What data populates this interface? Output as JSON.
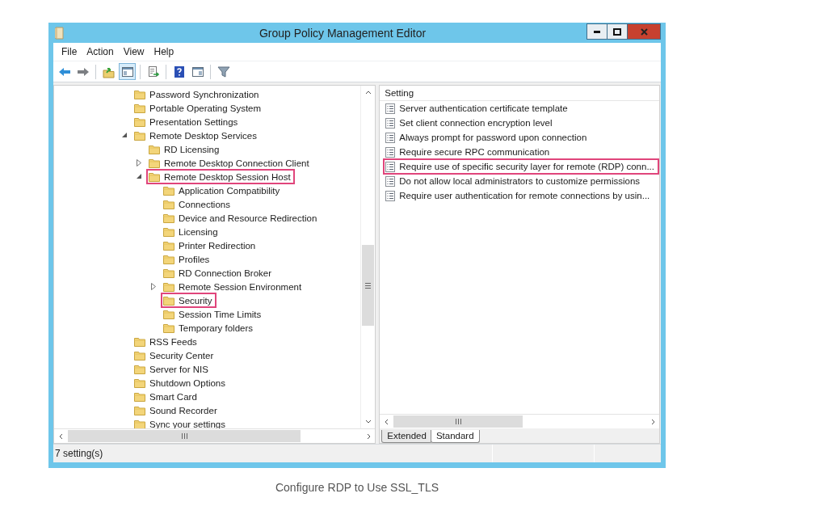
{
  "window": {
    "title": "Group Policy Management Editor"
  },
  "menu": [
    "File",
    "Action",
    "View",
    "Help"
  ],
  "tree": {
    "items": [
      {
        "label": "Password Synchronization",
        "highlighted": false
      },
      {
        "label": "Portable Operating System",
        "highlighted": false
      },
      {
        "label": "Presentation Settings",
        "highlighted": false
      },
      {
        "label": "Remote Desktop Services",
        "highlighted": false,
        "expanded": true,
        "children": [
          {
            "label": "RD Licensing",
            "highlighted": false
          },
          {
            "label": "Remote Desktop Connection Client",
            "highlighted": false,
            "expanded": false
          },
          {
            "label": "Remote Desktop Session Host",
            "highlighted": true,
            "expanded": true,
            "children": [
              {
                "label": "Application Compatibility",
                "highlighted": false
              },
              {
                "label": "Connections",
                "highlighted": false
              },
              {
                "label": "Device and Resource Redirection",
                "highlighted": false
              },
              {
                "label": "Licensing",
                "highlighted": false
              },
              {
                "label": "Printer Redirection",
                "highlighted": false
              },
              {
                "label": "Profiles",
                "highlighted": false
              },
              {
                "label": "RD Connection Broker",
                "highlighted": false
              },
              {
                "label": "Remote Session Environment",
                "highlighted": false,
                "expanded": false
              },
              {
                "label": "Security",
                "highlighted": true
              },
              {
                "label": "Session Time Limits",
                "highlighted": false
              },
              {
                "label": "Temporary folders",
                "highlighted": false
              }
            ]
          }
        ]
      },
      {
        "label": "RSS Feeds",
        "highlighted": false
      },
      {
        "label": "Security Center",
        "highlighted": false
      },
      {
        "label": "Server for NIS",
        "highlighted": false
      },
      {
        "label": "Shutdown Options",
        "highlighted": false
      },
      {
        "label": "Smart Card",
        "highlighted": false
      },
      {
        "label": "Sound Recorder",
        "highlighted": false
      },
      {
        "label": "Sync your settings",
        "highlighted": false
      }
    ]
  },
  "settings_list": {
    "header": "Setting",
    "items": [
      {
        "label": "Server authentication certificate template",
        "highlighted": false
      },
      {
        "label": "Set client connection encryption level",
        "highlighted": false
      },
      {
        "label": "Always prompt for password upon connection",
        "highlighted": false
      },
      {
        "label": "Require secure RPC communication",
        "highlighted": false
      },
      {
        "label": "Require use of specific security layer for remote (RDP) conn...",
        "highlighted": true
      },
      {
        "label": "Do not allow local administrators to customize permissions",
        "highlighted": false
      },
      {
        "label": "Require user authentication for remote connections by usin...",
        "highlighted": false
      }
    ]
  },
  "view_tabs": [
    {
      "label": "Extended",
      "selected": false
    },
    {
      "label": "Standard",
      "selected": true
    }
  ],
  "status_bar": {
    "text": "7 setting(s)"
  },
  "caption": "Configure RDP to Use SSL_TLS"
}
